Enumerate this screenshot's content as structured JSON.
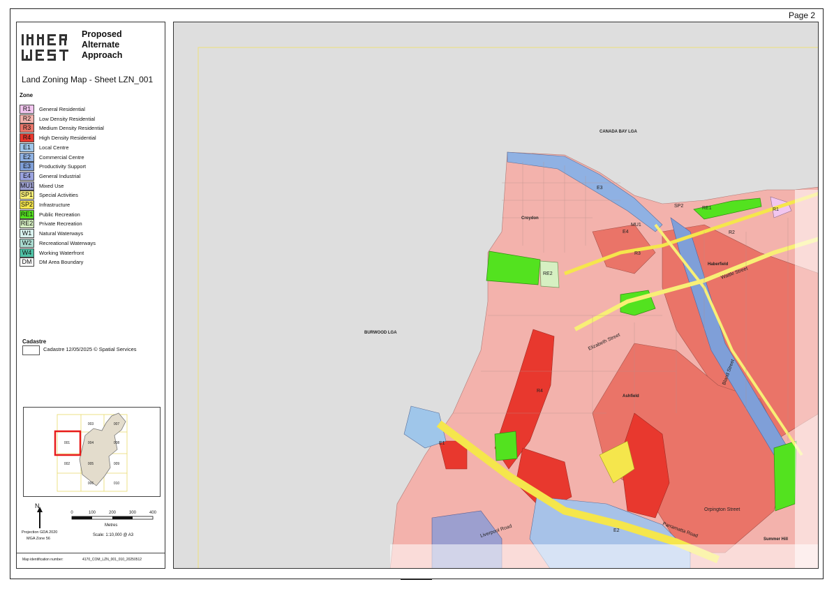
{
  "page_label": "Page 2",
  "logo": {
    "text_lines": [
      "Proposed",
      "Alternate",
      "Approach"
    ],
    "logo_name": "inner-west-logo"
  },
  "map_title": "Land Zoning Map - Sheet LZN_001",
  "legend": {
    "zone_heading": "Zone",
    "zones": [
      {
        "code": "R1",
        "label": "General Residential",
        "color": "#f2c6ef"
      },
      {
        "code": "R2",
        "label": "Low Density Residential",
        "color": "#f3b2ac"
      },
      {
        "code": "R3",
        "label": "Medium Density Residential",
        "color": "#ea7468"
      },
      {
        "code": "R4",
        "label": "High Density Residential",
        "color": "#e8382e"
      },
      {
        "code": "E1",
        "label": "Local Centre",
        "color": "#9fc6ea"
      },
      {
        "code": "E2",
        "label": "Commercial Centre",
        "color": "#8fb1e3"
      },
      {
        "code": "E3",
        "label": "Productivity Support",
        "color": "#7f9fd8"
      },
      {
        "code": "E4",
        "label": "General Industrial",
        "color": "#9aa3e0"
      },
      {
        "code": "MU1",
        "label": "Mixed Use",
        "color": "#9c9fcf"
      },
      {
        "code": "SP1",
        "label": "Special Activities",
        "color": "#f8ef76"
      },
      {
        "code": "SP2",
        "label": "Infrastructure",
        "color": "#f5e64c"
      },
      {
        "code": "RE1",
        "label": "Public Recreation",
        "color": "#53e21f"
      },
      {
        "code": "RE2",
        "label": "Private Recreation",
        "color": "#d6f0c2"
      },
      {
        "code": "W1",
        "label": "Natural Waterways",
        "color": "#d9f2ef"
      },
      {
        "code": "W2",
        "label": "Recreational Waterways",
        "color": "#a9dbd0"
      },
      {
        "code": "W4",
        "label": "Working Waterfront",
        "color": "#4fc2a6"
      },
      {
        "code": "DM",
        "label": "DM Area Boundary",
        "color": "#ffffff"
      }
    ],
    "cadastre_heading": "Cadastre",
    "cadastre_label": "Cadastre 12/05/2025 © Spatial Services"
  },
  "inset": {
    "sheets": [
      "003",
      "007",
      "001",
      "004",
      "008",
      "002",
      "005",
      "009",
      "006",
      "010"
    ],
    "highlight_sheet": "001"
  },
  "north_letter": "N",
  "projection": [
    "Projection GDA 2020",
    "MGA Zone 56"
  ],
  "scale": {
    "ticks": [
      "0",
      "100",
      "200",
      "300",
      "400"
    ],
    "units": "Metres",
    "ratio": "Scale: 1:10,000 @ A3"
  },
  "map_id": {
    "label": "Map identification number:",
    "value": "4170_COM_LZN_001_010_20250512"
  },
  "map": {
    "lga_labels": [
      "CANADA BAY LGA",
      "BURWOOD LGA"
    ],
    "suburbs": [
      "Croydon",
      "Haberfield",
      "Ashfield",
      "Summer Hill"
    ],
    "streets": [
      "Wattle Street",
      "Elizabeth Street",
      "Liverpool Road",
      "Orpington Street",
      "Bland Street",
      "Parramatta Road"
    ],
    "zone_labels": [
      {
        "code": "E3",
        "row": "north"
      },
      {
        "code": "RE1",
        "row": "north"
      },
      {
        "code": "SP2",
        "row": "north"
      },
      {
        "code": "R1",
        "row": "north"
      },
      {
        "code": "R2",
        "row": "north"
      },
      {
        "code": "R3",
        "row": "north"
      },
      {
        "code": "E4",
        "row": "north"
      },
      {
        "code": "MU1",
        "row": "north"
      },
      {
        "code": "RE2",
        "row": "north"
      },
      {
        "code": "R4",
        "row": "central"
      },
      {
        "code": "E1",
        "row": "central"
      },
      {
        "code": "E2",
        "row": "south"
      }
    ]
  }
}
